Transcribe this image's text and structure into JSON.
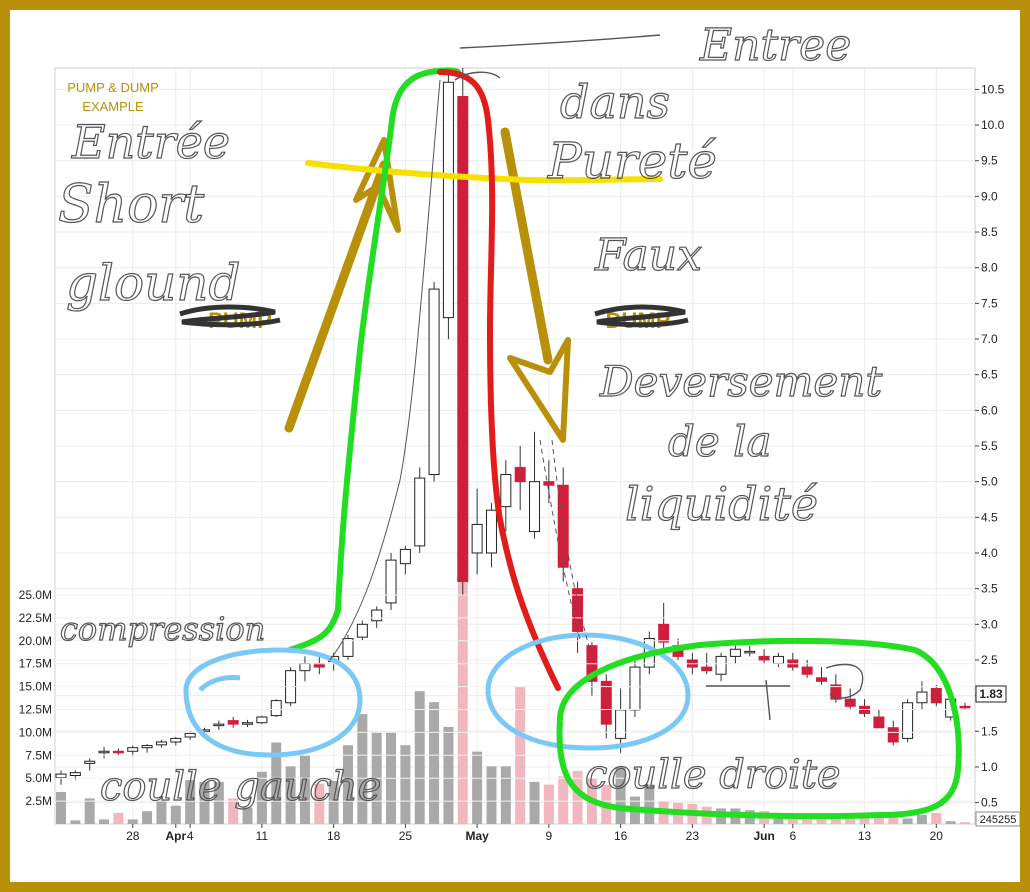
{
  "colors": {
    "frame": "#b8900a",
    "up_candle": "#ffffff",
    "down_candle": "#d01f3c",
    "volume_up": "#a9a9a9",
    "volume_down": "#f0b8be",
    "green": "#22dd22",
    "red": "#e21b1b",
    "yellow": "#f7e000",
    "blue": "#7cc8f5",
    "arrow": "#b8900a"
  },
  "chart_data": {
    "type": "candlestick",
    "title": "PUMP & DUMP\nEXAMPLE",
    "phase_labels": [
      "PUMP",
      "DUMP"
    ],
    "price_axis": {
      "min": 0.2,
      "max": 10.8,
      "ticks": [
        0.5,
        1.0,
        1.5,
        2.0,
        2.5,
        3.0,
        3.5,
        4.0,
        4.5,
        5.0,
        5.5,
        6.0,
        6.5,
        7.0,
        7.5,
        8.0,
        8.5,
        9.0,
        9.5,
        10.0,
        10.5
      ]
    },
    "volume_axis": {
      "min": 0,
      "max": 25,
      "unit": "M",
      "ticks": [
        "2.5M",
        "5.0M",
        "7.5M",
        "10.0M",
        "12.5M",
        "15.0M",
        "17.5M",
        "20.0M",
        "22.5M",
        "25.0M"
      ]
    },
    "last_price_label": "1.83",
    "last_volume_label": "245255",
    "x_labels": [
      {
        "text": "28",
        "i": 5
      },
      {
        "text": "Apr",
        "i": 8,
        "bold": true
      },
      {
        "text": "4",
        "i": 9
      },
      {
        "text": "11",
        "i": 14
      },
      {
        "text": "18",
        "i": 19
      },
      {
        "text": "25",
        "i": 24
      },
      {
        "text": "May",
        "i": 29,
        "bold": true
      },
      {
        "text": "9",
        "i": 34
      },
      {
        "text": "16",
        "i": 39
      },
      {
        "text": "23",
        "i": 44
      },
      {
        "text": "Jun",
        "i": 49,
        "bold": true
      },
      {
        "text": "6",
        "i": 51
      },
      {
        "text": "13",
        "i": 56
      },
      {
        "text": "20",
        "i": 61
      }
    ],
    "candles": [
      {
        "o": 0.85,
        "h": 0.95,
        "l": 0.75,
        "c": 0.9
      },
      {
        "o": 0.88,
        "h": 0.95,
        "l": 0.82,
        "c": 0.92
      },
      {
        "o": 1.05,
        "h": 1.12,
        "l": 0.95,
        "c": 1.08
      },
      {
        "o": 1.2,
        "h": 1.28,
        "l": 1.12,
        "c": 1.22
      },
      {
        "o": 1.22,
        "h": 1.26,
        "l": 1.16,
        "c": 1.21
      },
      {
        "o": 1.22,
        "h": 1.3,
        "l": 1.15,
        "c": 1.27
      },
      {
        "o": 1.27,
        "h": 1.32,
        "l": 1.2,
        "c": 1.3
      },
      {
        "o": 1.31,
        "h": 1.38,
        "l": 1.27,
        "c": 1.35
      },
      {
        "o": 1.35,
        "h": 1.42,
        "l": 1.3,
        "c": 1.4
      },
      {
        "o": 1.42,
        "h": 1.5,
        "l": 1.38,
        "c": 1.47
      },
      {
        "o": 1.5,
        "h": 1.55,
        "l": 1.45,
        "c": 1.52
      },
      {
        "o": 1.58,
        "h": 1.65,
        "l": 1.52,
        "c": 1.6
      },
      {
        "o": 1.65,
        "h": 1.7,
        "l": 1.55,
        "c": 1.6
      },
      {
        "o": 1.6,
        "h": 1.66,
        "l": 1.56,
        "c": 1.62
      },
      {
        "o": 1.62,
        "h": 1.72,
        "l": 1.6,
        "c": 1.7
      },
      {
        "o": 1.72,
        "h": 1.95,
        "l": 1.7,
        "c": 1.93
      },
      {
        "o": 1.9,
        "h": 2.4,
        "l": 1.85,
        "c": 2.35
      },
      {
        "o": 2.35,
        "h": 2.55,
        "l": 2.2,
        "c": 2.45
      },
      {
        "o": 2.45,
        "h": 2.55,
        "l": 2.3,
        "c": 2.4
      },
      {
        "o": 2.48,
        "h": 2.6,
        "l": 2.35,
        "c": 2.55
      },
      {
        "o": 2.55,
        "h": 2.85,
        "l": 2.5,
        "c": 2.8
      },
      {
        "o": 2.82,
        "h": 3.05,
        "l": 2.78,
        "c": 3.0
      },
      {
        "o": 3.05,
        "h": 3.25,
        "l": 2.95,
        "c": 3.2
      },
      {
        "o": 3.3,
        "h": 4.0,
        "l": 3.2,
        "c": 3.9
      },
      {
        "o": 3.85,
        "h": 4.1,
        "l": 3.7,
        "c": 4.05
      },
      {
        "o": 4.1,
        "h": 5.2,
        "l": 4.0,
        "c": 5.05
      },
      {
        "o": 5.1,
        "h": 7.8,
        "l": 5.0,
        "c": 7.7
      },
      {
        "o": 7.3,
        "h": 10.7,
        "l": 7.0,
        "c": 10.6
      },
      {
        "o": 10.4,
        "h": 10.8,
        "l": 3.4,
        "c": 3.6
      },
      {
        "o": 4.0,
        "h": 4.9,
        "l": 3.7,
        "c": 4.4
      },
      {
        "o": 4.0,
        "h": 4.7,
        "l": 3.8,
        "c": 4.6
      },
      {
        "o": 4.65,
        "h": 5.3,
        "l": 4.3,
        "c": 5.1
      },
      {
        "o": 5.2,
        "h": 5.5,
        "l": 4.6,
        "c": 5.0
      },
      {
        "o": 4.3,
        "h": 5.7,
        "l": 4.2,
        "c": 5.0
      },
      {
        "o": 5.0,
        "h": 5.3,
        "l": 4.7,
        "c": 4.95
      },
      {
        "o": 4.95,
        "h": 5.2,
        "l": 3.6,
        "c": 3.8
      },
      {
        "o": 3.5,
        "h": 3.6,
        "l": 2.6,
        "c": 2.9
      },
      {
        "o": 2.7,
        "h": 2.75,
        "l": 2.0,
        "c": 2.2
      },
      {
        "o": 2.2,
        "h": 2.3,
        "l": 1.4,
        "c": 1.6
      },
      {
        "o": 1.4,
        "h": 2.1,
        "l": 1.2,
        "c": 1.8
      },
      {
        "o": 1.8,
        "h": 2.5,
        "l": 1.7,
        "c": 2.4
      },
      {
        "o": 2.4,
        "h": 2.9,
        "l": 2.3,
        "c": 2.8
      },
      {
        "o": 3.0,
        "h": 3.3,
        "l": 2.6,
        "c": 2.75
      },
      {
        "o": 2.7,
        "h": 2.8,
        "l": 2.5,
        "c": 2.55
      },
      {
        "o": 2.5,
        "h": 2.6,
        "l": 2.3,
        "c": 2.4
      },
      {
        "o": 2.4,
        "h": 2.6,
        "l": 2.3,
        "c": 2.35
      },
      {
        "o": 2.3,
        "h": 2.6,
        "l": 2.2,
        "c": 2.55
      },
      {
        "o": 2.55,
        "h": 2.7,
        "l": 2.45,
        "c": 2.65
      },
      {
        "o": 2.6,
        "h": 2.7,
        "l": 2.55,
        "c": 2.62
      },
      {
        "o": 2.55,
        "h": 2.65,
        "l": 2.45,
        "c": 2.5
      },
      {
        "o": 2.45,
        "h": 2.6,
        "l": 2.4,
        "c": 2.55
      },
      {
        "o": 2.5,
        "h": 2.6,
        "l": 2.35,
        "c": 2.4
      },
      {
        "o": 2.4,
        "h": 2.5,
        "l": 2.25,
        "c": 2.3
      },
      {
        "o": 2.25,
        "h": 2.4,
        "l": 2.15,
        "c": 2.2
      },
      {
        "o": 2.15,
        "h": 2.3,
        "l": 1.9,
        "c": 1.95
      },
      {
        "o": 1.95,
        "h": 2.1,
        "l": 1.8,
        "c": 1.85
      },
      {
        "o": 1.85,
        "h": 1.95,
        "l": 1.7,
        "c": 1.75
      },
      {
        "o": 1.7,
        "h": 1.8,
        "l": 1.55,
        "c": 1.55
      },
      {
        "o": 1.55,
        "h": 1.65,
        "l": 1.3,
        "c": 1.35
      },
      {
        "o": 1.4,
        "h": 1.95,
        "l": 1.35,
        "c": 1.9
      },
      {
        "o": 1.9,
        "h": 2.2,
        "l": 1.8,
        "c": 2.05
      },
      {
        "o": 2.1,
        "h": 2.15,
        "l": 1.85,
        "c": 1.9
      },
      {
        "o": 1.7,
        "h": 2.0,
        "l": 1.65,
        "c": 1.95
      },
      {
        "o": 1.85,
        "h": 1.9,
        "l": 1.8,
        "c": 1.83
      }
    ],
    "volume": [
      3.5,
      0.4,
      2.8,
      0.5,
      1.2,
      0.5,
      1.4,
      2.5,
      2.0,
      4.8,
      4.6,
      4.6,
      2.8,
      1.8,
      5.7,
      8.9,
      6.3,
      7.5,
      4.4,
      4.7,
      8.6,
      12.0,
      10.0,
      10.0,
      8.6,
      14.5,
      13.3,
      10.6,
      31.0,
      7.9,
      6.3,
      6.3,
      15.0,
      4.6,
      4.3,
      5.2,
      5.8,
      5.0,
      4.3,
      6.2,
      3.0,
      4.3,
      2.5,
      2.3,
      2.2,
      1.9,
      1.7,
      1.7,
      1.5,
      1.4,
      1.2,
      1.0,
      1.0,
      1.0,
      0.9,
      0.8,
      0.8,
      0.7,
      0.7,
      0.6,
      1.0,
      1.2,
      0.3,
      0.2
    ]
  },
  "annotations": {
    "entree_short": [
      "Entrée",
      "Short",
      "glound"
    ],
    "entree_top": "Entree",
    "dans_purete": [
      "dans",
      "Pureté",
      "Faux"
    ],
    "deversement": [
      "Deversement",
      "de la",
      "liquidité"
    ],
    "compression": "compression",
    "coulle_gauche": "coulle gauche",
    "coulle_droite": "coulle droite"
  }
}
